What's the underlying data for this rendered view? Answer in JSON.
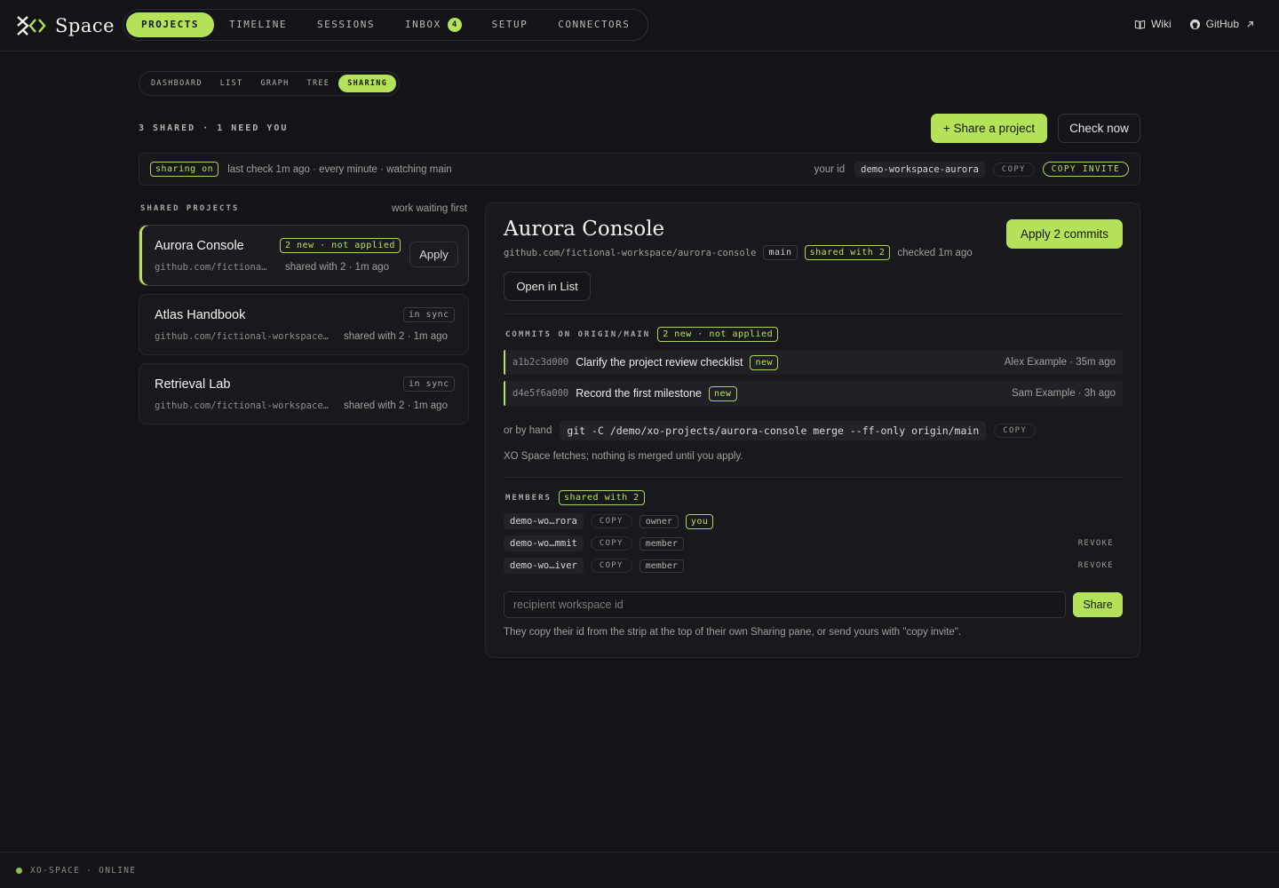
{
  "brand": {
    "name": "Space"
  },
  "nav": {
    "items": [
      {
        "label": "PROJECTS",
        "active": true
      },
      {
        "label": "TIMELINE"
      },
      {
        "label": "SESSIONS"
      },
      {
        "label": "INBOX",
        "count": "4"
      },
      {
        "label": "SETUP"
      },
      {
        "label": "CONNECTORS"
      }
    ]
  },
  "toplinks": {
    "wiki": "Wiki",
    "github": "GitHub"
  },
  "subtabs": [
    "DASHBOARD",
    "LIST",
    "GRAPH",
    "TREE",
    "SHARING"
  ],
  "summary": "3 SHARED · 1 NEED YOU",
  "actions": {
    "share_project": "+ Share a project",
    "check_now": "Check now"
  },
  "strip": {
    "status": "sharing on",
    "last_check": "last check 1m ago · every minute · watching main",
    "your_id_label": "your id",
    "your_id": "demo-workspace-aurora",
    "copy": "COPY",
    "copy_invite": "COPY INVITE"
  },
  "shared": {
    "title": "SHARED PROJECTS",
    "sort": "work waiting first",
    "projects": [
      {
        "name": "Aurora Console",
        "repo": "github.com/fictional-workspace/aurora-console",
        "status": "2 new · not applied",
        "meta": "shared with 2 · 1m ago",
        "apply": "Apply"
      },
      {
        "name": "Atlas Handbook",
        "repo": "github.com/fictional-workspace/atlas-handbook",
        "status": "in sync",
        "meta": "shared with 2 · 1m ago"
      },
      {
        "name": "Retrieval Lab",
        "repo": "github.com/fictional-workspace/retrieval-lab",
        "status": "in sync",
        "meta": "shared with 2 · 1m ago"
      }
    ]
  },
  "detail": {
    "title": "Aurora Console",
    "apply_commits": "Apply 2 commits",
    "repo": "github.com/fictional-workspace/aurora-console",
    "branch": "main",
    "shared_with": "shared with 2",
    "checked": "checked 1m ago",
    "open_in_list": "Open in List",
    "commits_title": "COMMITS ON ORIGIN/MAIN",
    "commits_badge": "2 new · not applied",
    "commits": [
      {
        "hash": "a1b2c3d000",
        "message": "Clarify the project review checklist",
        "tag": "new",
        "author": "Alex Example · 35m ago"
      },
      {
        "hash": "d4e5f6a000",
        "message": "Record the first milestone",
        "tag": "new",
        "author": "Sam Example · 3h ago"
      }
    ],
    "by_hand_label": "or by hand",
    "command": "git -C /demo/xo-projects/aurora-console merge --ff-only origin/main",
    "copy": "COPY",
    "fetch_note": "XO Space fetches; nothing is merged until you apply.",
    "members_title": "MEMBERS",
    "members_badge": "shared with 2",
    "members": [
      {
        "id": "demo-wo…rora",
        "role": "owner",
        "you": "you"
      },
      {
        "id": "demo-wo…mmit",
        "role": "member",
        "revoke": "REVOKE"
      },
      {
        "id": "demo-wo…iver",
        "role": "member",
        "revoke": "REVOKE"
      }
    ],
    "recipient_placeholder": "recipient workspace id",
    "share": "Share",
    "share_note": "They copy their id from the strip at the top of their own Sharing pane, or send yours with \"copy invite\"."
  },
  "footer": {
    "status": "XO-SPACE · ONLINE"
  },
  "colors": {
    "accent": "#b4e35a",
    "background": "#131318"
  },
  "icons": {
    "brand": "xo-logo-icon",
    "wiki": "book-icon",
    "github": "github-icon",
    "external": "external-link-icon",
    "status": "status-dot-icon"
  }
}
